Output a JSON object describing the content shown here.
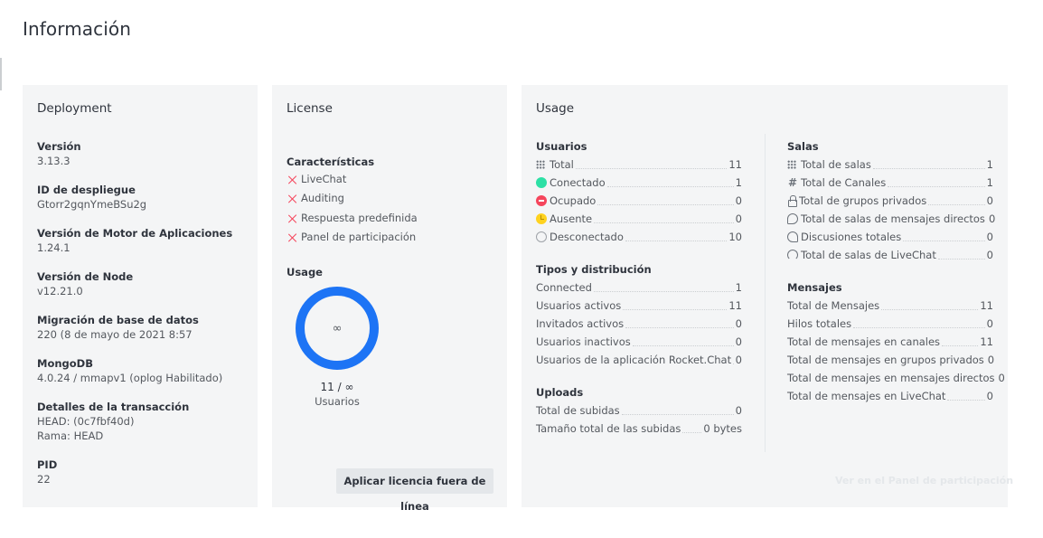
{
  "page": {
    "title": "Información"
  },
  "deployment": {
    "title": "Deployment",
    "fields": [
      {
        "label": "Versión",
        "value": "3.13.3"
      },
      {
        "label": "ID de despliegue",
        "value": "Gtorr2gqnYmeBSu2g"
      },
      {
        "label": "Versión de Motor de Aplicaciones",
        "value": "1.24.1"
      },
      {
        "label": "Versión de Node",
        "value": "v12.21.0"
      },
      {
        "label": "Migración de base de datos",
        "value": "220 (8 de mayo de 2021 8:57"
      },
      {
        "label": "MongoDB",
        "value": "4.0.24 / mmapv1 (oplog Habilitado)"
      },
      {
        "label": "Detalles de la transacción",
        "value": "HEAD: (0c7fbf40d)",
        "value2": "Rama: HEAD"
      },
      {
        "label": "PID",
        "value": "22"
      }
    ]
  },
  "license": {
    "title": "License",
    "features_title": "Características",
    "features": [
      "LiveChat",
      "Auditing",
      "Respuesta predefinida",
      "Panel de participación"
    ],
    "usage_title": "Usage",
    "donut_center": "∞",
    "usage_count": "11 / ∞",
    "usage_label": "Usuarios",
    "offline_button": "Aplicar licencia fuera de línea",
    "colors": {
      "donut": "#1d74f5",
      "feature_icon": "#f5455c"
    }
  },
  "usage": {
    "title": "Usage",
    "users": {
      "title": "Usuarios",
      "rows": [
        {
          "icon": "grid-icon",
          "label": "Total",
          "value": "11"
        },
        {
          "icon": "online-status-icon",
          "label": "Conectado",
          "value": "1"
        },
        {
          "icon": "busy-status-icon",
          "label": "Ocupado",
          "value": "0"
        },
        {
          "icon": "away-status-icon",
          "label": "Ausente",
          "value": "0"
        },
        {
          "icon": "offline-status-icon",
          "label": "Desconectado",
          "value": "10"
        }
      ]
    },
    "types": {
      "title": "Tipos y distribución",
      "rows": [
        {
          "label": "Connected",
          "value": "1"
        },
        {
          "label": "Usuarios activos",
          "value": "11"
        },
        {
          "label": "Invitados activos",
          "value": "0"
        },
        {
          "label": "Usuarios inactivos",
          "value": "0"
        },
        {
          "label": "Usuarios de la aplicación Rocket.Chat",
          "value": "0"
        }
      ]
    },
    "uploads": {
      "title": "Uploads",
      "rows": [
        {
          "label": "Total de subidas",
          "value": "0"
        },
        {
          "label": "Tamaño total de las subidas",
          "value": "0 bytes"
        }
      ]
    },
    "rooms": {
      "title": "Salas",
      "rows": [
        {
          "icon": "grid-icon",
          "label": "Total de salas",
          "value": "1"
        },
        {
          "icon": "hashtag-icon",
          "label": "Total de Canales",
          "value": "1"
        },
        {
          "icon": "lock-icon",
          "label": "Total de grupos privados",
          "value": "0"
        },
        {
          "icon": "chat-bubble-icon",
          "label": "Total de salas de mensajes directos",
          "value": "0"
        },
        {
          "icon": "discussion-icon",
          "label": "Discusiones totales",
          "value": "0"
        },
        {
          "icon": "headset-icon",
          "label": "Total de salas de LiveChat",
          "value": "0"
        }
      ]
    },
    "messages": {
      "title": "Mensajes",
      "rows": [
        {
          "label": "Total de Mensajes",
          "value": "11"
        },
        {
          "label": "Hilos totales",
          "value": "0"
        },
        {
          "label": "Total de mensajes en canales",
          "value": "11"
        },
        {
          "label": "Total de mensajes en grupos privados",
          "value": "0"
        },
        {
          "label": "Total de mensajes en mensajes directos",
          "value": "0"
        },
        {
          "label": "Total de mensajes en LiveChat",
          "value": "0"
        }
      ]
    },
    "engagement_link": "Ver en el Panel de participación"
  }
}
